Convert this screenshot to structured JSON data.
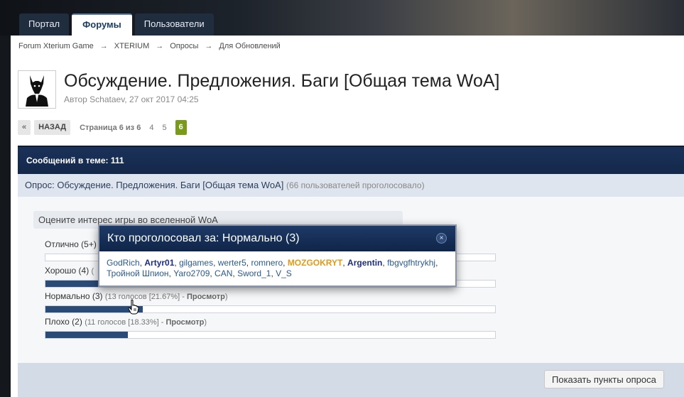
{
  "nav": {
    "tabs": [
      {
        "label": "Портал"
      },
      {
        "label": "Форумы"
      },
      {
        "label": "Пользователи"
      }
    ]
  },
  "breadcrumb": [
    "Forum Xterium Game",
    "XTERIUM",
    "Опросы",
    "Для Обновлений"
  ],
  "breadcrumb_sep": "→",
  "thread": {
    "title": "Обсуждение. Предложения. Баги [Общая тема WoA]",
    "author": "Автор Schataev, 27 окт 2017 04:25"
  },
  "pager": {
    "prev": "«",
    "back": "НАЗАД",
    "info": "Страница 6 из 6",
    "pages": [
      "4",
      "5"
    ],
    "current": "6"
  },
  "messages_count": "Сообщений в теме: 111",
  "poll": {
    "title": "Опрос: Обсуждение. Предложения. Баги [Общая тема WoA]",
    "voters_note": "(66 пользователей проголосовало)",
    "question": "Оцените интерес игры во вселенной WoA",
    "options": [
      {
        "label": "Отлично (5+)",
        "meta": "",
        "link": "",
        "fill": 0.0
      },
      {
        "label": "Хорошо (4)",
        "meta": "(",
        "link": "",
        "fill": 0.33
      },
      {
        "label": "Нормально (3)",
        "meta": "(13 голосов [21.67%] - ",
        "link": "Просмотр",
        "fill": 0.2167
      },
      {
        "label": "Плохо (2)",
        "meta": "(11 голосов [18.33%] - ",
        "link": "Просмотр",
        "fill": 0.1833
      }
    ],
    "show_button": "Показать пункты опроса"
  },
  "popup": {
    "title": "Кто проголосовал за: Нормально (3)",
    "close": "×",
    "voters": [
      {
        "name": "GodRich",
        "style": ""
      },
      {
        "name": "Artyr01",
        "style": "bold"
      },
      {
        "name": "gilgames",
        "style": ""
      },
      {
        "name": "werter5",
        "style": ""
      },
      {
        "name": "romnero",
        "style": ""
      },
      {
        "name": "MOZGOKRYT",
        "style": "gold"
      },
      {
        "name": "Argentin",
        "style": "bold"
      },
      {
        "name": "fbgvgfhtrykhj",
        "style": ""
      },
      {
        "name": "Тройной Шпион",
        "style": ""
      },
      {
        "name": "Yaro2709",
        "style": ""
      },
      {
        "name": "CAN",
        "style": ""
      },
      {
        "name": "Sword_1",
        "style": ""
      },
      {
        "name": "V_S",
        "style": ""
      }
    ]
  },
  "colors": {
    "header_bar": "#14284b",
    "current_page": "#7a9a1a",
    "poll_fill": "#2a4a78"
  }
}
